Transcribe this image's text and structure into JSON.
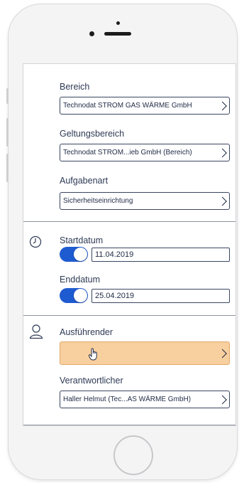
{
  "form": {
    "bereich": {
      "label": "Bereich",
      "value": "Technodat STROM GAS WÄRME GmbH"
    },
    "geltungsbereich": {
      "label": "Geltungsbereich",
      "value": "Technodat STROM...ieb GmbH (Bereich)"
    },
    "aufgabenart": {
      "label": "Aufgabenart",
      "value": "Sicherheitseinrichtung"
    },
    "startdatum": {
      "label": "Startdatum",
      "value": "11.04.2019",
      "enabled": true
    },
    "enddatum": {
      "label": "Enddatum",
      "value": "25.04.2019",
      "enabled": true
    },
    "ausfuehrender": {
      "label": "Ausführender",
      "value": "",
      "highlight_color": "#f8cf9e"
    },
    "verantwortlicher": {
      "label": "Verantwortlicher",
      "value": "Haller Helmut (Tec...AS WÄRME GmbH)"
    }
  },
  "icons": {
    "dates": "clock-icon",
    "people": "person-icon",
    "cursor": "hand-pointer-icon"
  },
  "colors": {
    "toggle_on": "#1f5bd0",
    "text": "#2e3a55",
    "highlight": "#f8cf9e"
  }
}
